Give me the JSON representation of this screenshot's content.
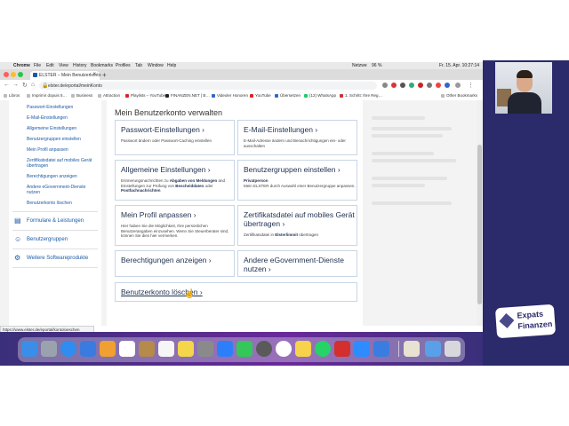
{
  "menubar": {
    "app": "Chrome",
    "items": [
      "File",
      "Edit",
      "View",
      "History",
      "Bookmarks",
      "Profiles",
      "Tab",
      "Window",
      "Help"
    ],
    "status_lang": "Netzwe",
    "battery": "96 %",
    "clock": "Fr. 15. Apr. 10:27:14"
  },
  "browser": {
    "tab_title": "ELSTER – Mein Benutzerkonto",
    "url": "elster.de/eportal/meinKonto",
    "bookmarks": [
      "Libros",
      "Imprimir dopuis 5…",
      "Business",
      "Attraction",
      "Playlists – YouTube",
      "FINANZEN.NET | B…",
      "Videoler Honoren",
      "YouTube",
      "Übersetzen",
      "(12) WhatsApp",
      "1. Schritt: Ihre Reg…"
    ],
    "other_bookmarks": "Other Bookmarks",
    "status_link": "https://www.elster.de/eportal/kontoloeschen"
  },
  "sidebar": {
    "sub_items": [
      "Passwort-Einstellungen",
      "E-Mail-Einstellungen",
      "Allgemeine Einstellungen",
      "Benutzergruppen einstellen",
      "Mein Profil anpassen",
      "Zertifikatsdatei auf mobiles Gerät übertragen",
      "Berechtigungen anzeigen",
      "Andere eGovernment-Dienste nutzen",
      "Benutzerkonto löschen"
    ],
    "main_items": [
      "Formulare & Leistungen",
      "Benutzergruppen",
      "Weitere Softwareprodukte"
    ]
  },
  "main": {
    "heading": "Mein Benutzerkonto verwalten",
    "cards": [
      {
        "title": "Passwort-Einstellungen ›",
        "desc": "Passwort ändern oder Passwort-Caching einstellen"
      },
      {
        "title": "E-Mail-Einstellungen ›",
        "desc": "E-Mail-Adresse ändern und Benachrichtigungen ein- oder ausschalten"
      },
      {
        "title": "Allgemeine Einstellungen ›",
        "desc_pre": "Erinnerungsnachrichten zu ",
        "desc_b1": "Abgaben von Meldungen",
        "desc_mid": " and Einstellungen zur Prüfung von ",
        "desc_b2": "Bescheiddaten",
        "desc_mid2": " oder ",
        "desc_b3": "Postfachnachrichten"
      },
      {
        "title": "Benutzergruppen einstellen ›",
        "desc_b": "Privatperson",
        "desc": "Mein ELSTER durch Auswahl einer Benutzergruppe anpassen."
      },
      {
        "title": "Mein Profil anpassen ›",
        "desc": "Hier haben Sie die Möglichkeit, Ihre persönlichen Benutzerangaben einzusehen. Wenn Sie Steuerberater sind, können Sie dies hier vermerken."
      },
      {
        "title": "Zertifikatsdatei auf mobiles Gerät übertragen ›",
        "desc_pre": "Zertifikatsdatei in ",
        "desc_b": "Elsterlimmit",
        "desc_post": " übertragen"
      },
      {
        "title": "Berechtigungen anzeigen ›"
      },
      {
        "title": "Andere eGovernment-Dienste nutzen ›"
      },
      {
        "title": "Benutzerkonto löschen ›"
      }
    ]
  },
  "logo": {
    "line1": "Expats",
    "line2": "Finanzen"
  },
  "colors": {
    "link": "#1b5aa6",
    "card_border": "#c9d6e6",
    "panel": "#2b2a6a"
  }
}
